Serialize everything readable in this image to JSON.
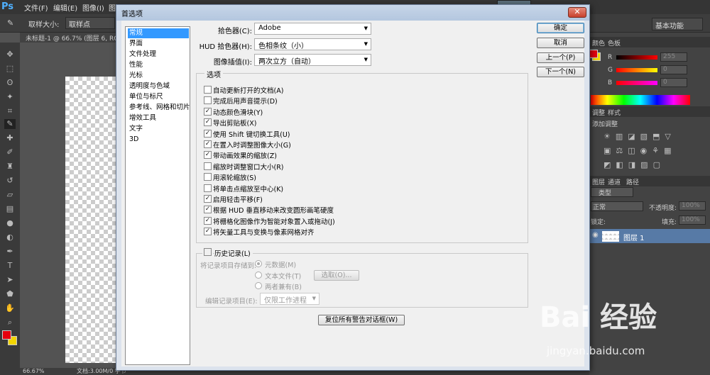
{
  "app": {
    "logo": "Ps",
    "menu": [
      "文件(F)",
      "编辑(E)",
      "图像(I)",
      "图层"
    ],
    "options_bar": {
      "sample_size_label": "取样大小:",
      "sample_size_value": "取样点"
    },
    "workspace": "基本功能",
    "doc_tab": "未标题-1 @ 66.7% (图层 6, RGB/8",
    "status": {
      "zoom": "66.67%",
      "doc_info": "文档:3.00M/0 字节"
    }
  },
  "right_panel": {
    "color_tabs": [
      "颜色",
      "色板"
    ],
    "rgb": [
      {
        "label": "R",
        "value": "255"
      },
      {
        "label": "G",
        "value": "0"
      },
      {
        "label": "B",
        "value": "0"
      }
    ],
    "adjust_tabs": [
      "调整",
      "样式"
    ],
    "adjust_title": "添加调整",
    "layers_tabs": [
      "图层",
      "通道",
      "路径"
    ],
    "filter_kind": "类型",
    "blend_mode": "正常",
    "opacity_label": "不透明度:",
    "opacity_value": "100%",
    "lock_label": "锁定:",
    "fill_label": "填充:",
    "fill_value": "100%",
    "layer_name": "图层 1"
  },
  "dialog": {
    "title": "首选项",
    "close": "✕",
    "categories": [
      "常规",
      "界面",
      "文件处理",
      "性能",
      "光标",
      "透明度与色域",
      "单位与标尺",
      "参考线、网格和切片",
      "增效工具",
      "文字",
      "3D"
    ],
    "selected_category": 0,
    "color_picker": {
      "label": "拾色器(C):",
      "value": "Adobe"
    },
    "hud_picker": {
      "label": "HUD 拾色器(H):",
      "value": "色相条纹（小）"
    },
    "interpolation": {
      "label": "图像插值(I):",
      "value": "两次立方（自动）"
    },
    "options_title": "选项",
    "options": [
      {
        "label": "自动更新打开的文档(A)",
        "checked": false
      },
      {
        "label": "完成后用声音提示(D)",
        "checked": false
      },
      {
        "label": "动态颜色滑块(Y)",
        "checked": true
      },
      {
        "label": "导出剪贴板(X)",
        "checked": true
      },
      {
        "label": "使用 Shift 键切换工具(U)",
        "checked": true
      },
      {
        "label": "在置入时调整图像大小(G)",
        "checked": true
      },
      {
        "label": "带动画效果的缩放(Z)",
        "checked": true
      },
      {
        "label": "缩放时调整窗口大小(R)",
        "checked": false
      },
      {
        "label": "用滚轮缩放(S)",
        "checked": false
      },
      {
        "label": "将单击点缩放至中心(K)",
        "checked": false
      },
      {
        "label": "启用轻击平移(F)",
        "checked": true
      },
      {
        "label": "根据 HUD 垂直移动来改变圆形画笔硬度",
        "checked": true
      },
      {
        "label": "将栅格化图像作为智能对象置入或拖动(J)",
        "checked": true
      },
      {
        "label": "将矢量工具与变换与像素网格对齐",
        "checked": true
      }
    ],
    "history": {
      "title": "历史记录(L)",
      "checked": false,
      "save_to_label": "将记录项目存储到:",
      "radios": [
        {
          "label": "元数据(M)",
          "selected": true
        },
        {
          "label": "文本文件(T)",
          "selected": false
        },
        {
          "label": "两者兼有(B)",
          "selected": false
        }
      ],
      "choose_button": "选取(O)...",
      "edit_log_label": "编辑记录项目(E):",
      "edit_log_value": "仅限工作进程"
    },
    "reset_warnings": "复位所有警告对话框(W)",
    "buttons": {
      "ok": "确定",
      "cancel": "取消",
      "prev": "上一个(P)",
      "next": "下一个(N)"
    }
  },
  "watermark": {
    "text": "Bai 经验",
    "url": "jingyan.baidu.com"
  }
}
